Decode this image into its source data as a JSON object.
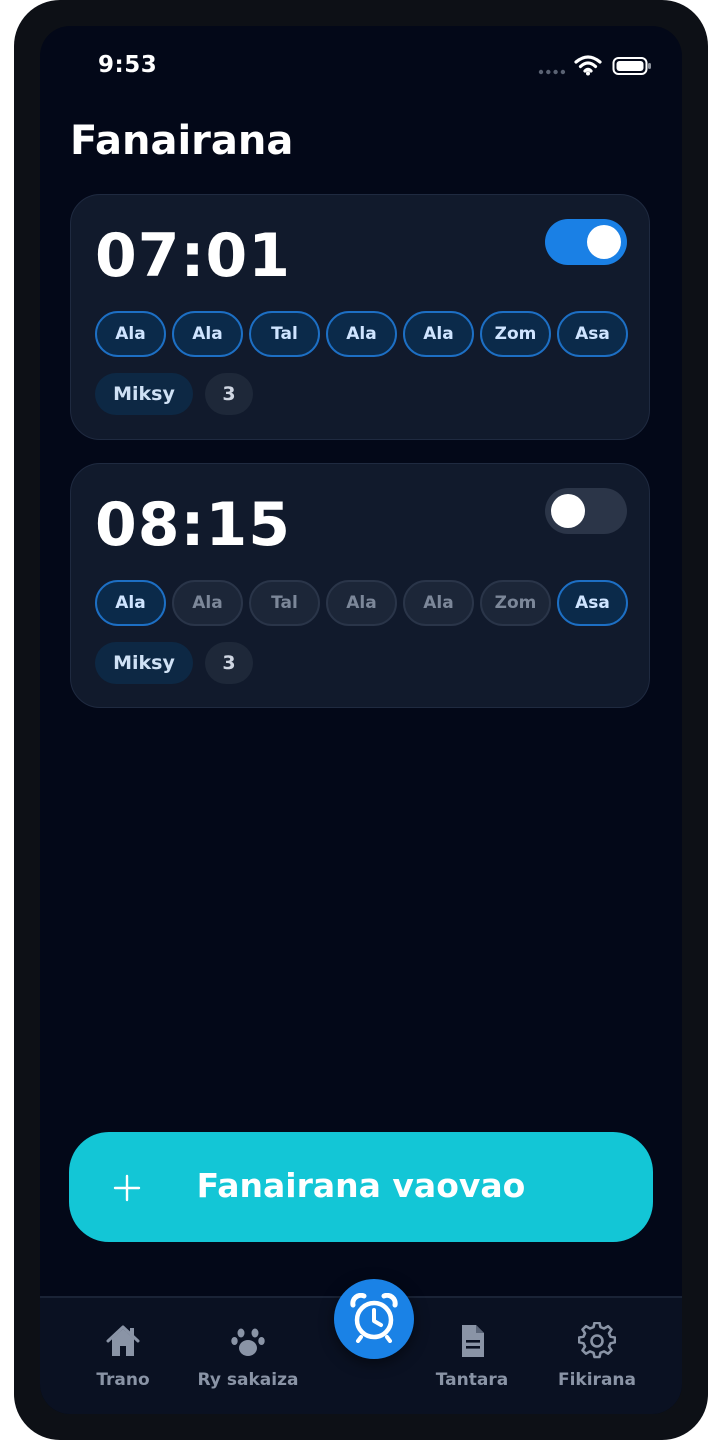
{
  "status_bar": {
    "time": "9:53"
  },
  "page": {
    "title": "Fanairana"
  },
  "alarms": [
    {
      "time": "07:01",
      "enabled": true,
      "days": [
        {
          "label": "Ala",
          "active": true
        },
        {
          "label": "Ala",
          "active": true
        },
        {
          "label": "Tal",
          "active": true
        },
        {
          "label": "Ala",
          "active": true
        },
        {
          "label": "Ala",
          "active": true
        },
        {
          "label": "Zom",
          "active": true
        },
        {
          "label": "Asa",
          "active": true
        }
      ],
      "sound": "Miksy",
      "count": "3"
    },
    {
      "time": "08:15",
      "enabled": false,
      "days": [
        {
          "label": "Ala",
          "active": true
        },
        {
          "label": "Ala",
          "active": false
        },
        {
          "label": "Tal",
          "active": false
        },
        {
          "label": "Ala",
          "active": false
        },
        {
          "label": "Ala",
          "active": false
        },
        {
          "label": "Zom",
          "active": false
        },
        {
          "label": "Asa",
          "active": true
        }
      ],
      "sound": "Miksy",
      "count": "3"
    }
  ],
  "new_alarm": {
    "label": "Fanairana vaovao",
    "icon": "plus-icon"
  },
  "tab_bar": {
    "items": [
      {
        "label": "Trano",
        "icon": "home-icon"
      },
      {
        "label": "Ry sakaiza",
        "icon": "paw-icon"
      },
      {
        "label": "Tantara",
        "icon": "document-icon"
      },
      {
        "label": "Fikirana",
        "icon": "gear-icon"
      }
    ],
    "center": {
      "icon": "alarm-clock-icon",
      "active": true
    }
  },
  "colors": {
    "background": "#030818",
    "card": "#111a2c",
    "accent_blue": "#1a80e5",
    "button_cyan": "#13c6d6",
    "tab_inactive": "#8a94a6"
  }
}
